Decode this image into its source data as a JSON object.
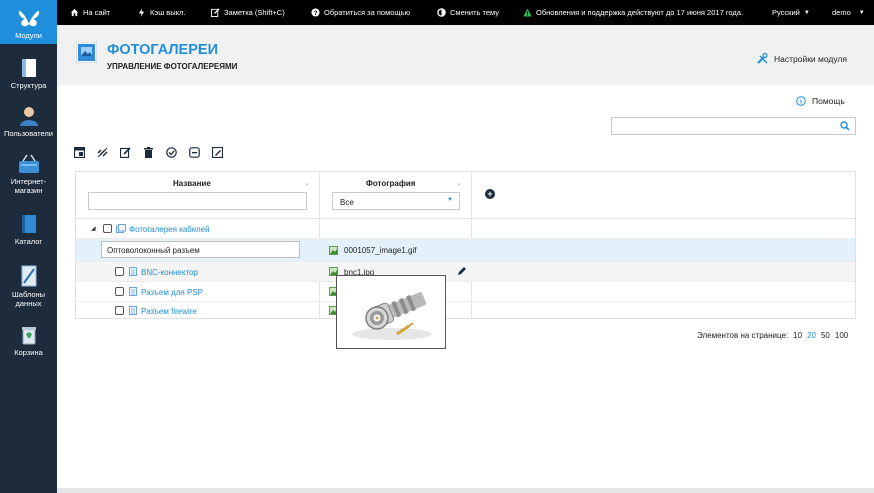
{
  "sidebar": {
    "items": [
      {
        "label": "Модули",
        "icon": "butterfly-icon"
      },
      {
        "label": "Структура",
        "icon": "structure-icon"
      },
      {
        "label": "Пользователи",
        "icon": "users-icon"
      },
      {
        "label": "Интернет-магазин",
        "label1": "Интернет-",
        "label2": "магазин",
        "icon": "shop-basket-icon"
      },
      {
        "label": "Каталог",
        "icon": "catalog-book-icon"
      },
      {
        "label": "Шаблоны данных",
        "label1": "Шаблоны",
        "label2": "данных",
        "icon": "data-templates-icon"
      },
      {
        "label": "Корзина",
        "icon": "recycle-bin-icon"
      }
    ]
  },
  "topbar": {
    "site": "На сайт",
    "cache": "Кэш выкл.",
    "note": "Заметка (Shift+C)",
    "help": "Обратиться за помощью",
    "theme": "Сменить тему",
    "updates": "Обновления и поддержка действуют до 17 июня 2017 года.",
    "language": "Русский",
    "user": "demo"
  },
  "header": {
    "title": "ФОТОГАЛЕРЕИ",
    "subtitle": "УПРАВЛЕНИЕ ФОТОГАЛЕРЕЯМИ",
    "settings": "Настройки модуля"
  },
  "help": {
    "label": "Помощь"
  },
  "search": {
    "value": "",
    "placeholder": ""
  },
  "grid": {
    "columns": [
      {
        "label": "Название"
      },
      {
        "label": "Фотография"
      }
    ],
    "filter_name": "",
    "filter_photo": "Все",
    "rows": [
      {
        "name": "Фотогалерея кабелей",
        "photo": ""
      },
      {
        "name": "Оптоволоконный разъем",
        "photo": "0001057_image1.gif"
      },
      {
        "name": "BNC-коннектор",
        "photo": "bnc1.jpg"
      },
      {
        "name": "Разъем для PSP",
        "photo": ""
      },
      {
        "name": "Разъем firewire",
        "photo": ""
      }
    ]
  },
  "pager": {
    "label": "Элементов на странице:",
    "options": [
      "10",
      "20",
      "50",
      "100"
    ],
    "current": "20"
  },
  "colors": {
    "accent": "#1f8fdb",
    "sidebar": "#1d2b3c",
    "topbar": "#000000"
  }
}
